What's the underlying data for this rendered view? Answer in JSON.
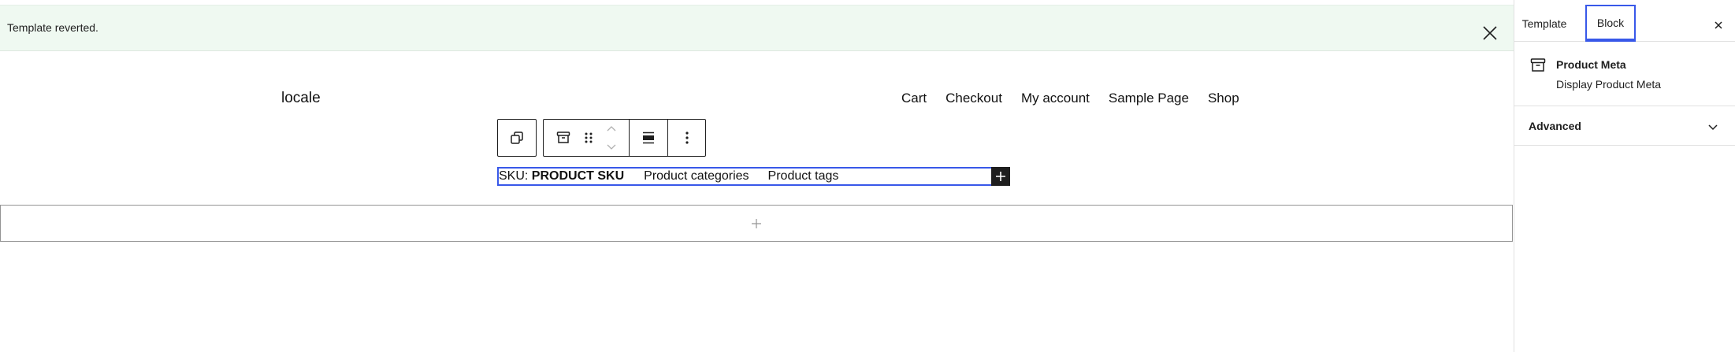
{
  "notice": {
    "text": "Template reverted."
  },
  "site": {
    "title": "locale",
    "nav": [
      "Cart",
      "Checkout",
      "My account",
      "Sample Page",
      "Shop"
    ]
  },
  "product_meta": {
    "sku_label": "SKU:",
    "sku_value": "PRODUCT SKU",
    "categories": "Product categories",
    "tags": "Product tags"
  },
  "sidebar": {
    "tabs": [
      "Template",
      "Block"
    ],
    "active_tab": "Block",
    "block": {
      "title": "Product Meta",
      "description": "Display Product Meta"
    },
    "advanced_label": "Advanced"
  },
  "colors": {
    "accent": "#3858e9",
    "notice_bg": "#eff9f1"
  }
}
